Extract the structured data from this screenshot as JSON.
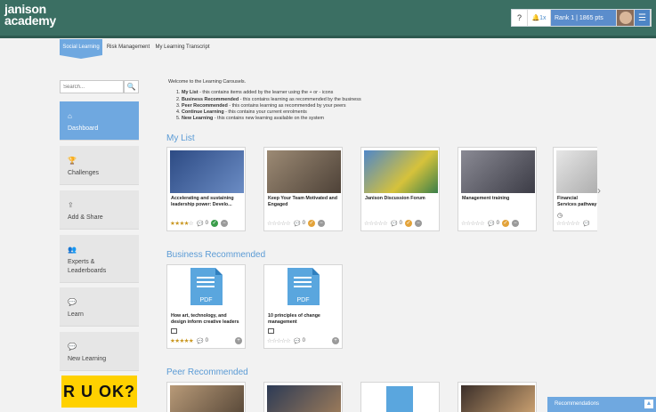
{
  "header": {
    "logo_line1": "janison",
    "logo_line2": "academy",
    "help": "?",
    "notifications": "1x",
    "rank": "Rank 1 | 1865 pts",
    "menu": "☰"
  },
  "tabs": [
    "Social Learning",
    "Risk Management",
    "My Learning Transcript"
  ],
  "search": {
    "placeholder": "Search..."
  },
  "sidebar": [
    {
      "label": "Dashboard",
      "icon": "⌂"
    },
    {
      "label": "Challenges",
      "icon": "🏆"
    },
    {
      "label": "Add & Share",
      "icon": "⇪"
    },
    {
      "label": "Experts & Leaderboards",
      "icon": "👥"
    },
    {
      "label": "Learn",
      "icon": "💬"
    },
    {
      "label": "New Learning",
      "icon": "💬"
    }
  ],
  "ruok": "R U OK?",
  "intro": {
    "welcome": "Welcome to the Learning Carousels.",
    "items": [
      {
        "b": "My List",
        "t": " - this contains items added by the learner using the + or - icons"
      },
      {
        "b": "Business Recommended",
        "t": " - this contains learning as recommended by the business"
      },
      {
        "b": "Peer Recommended",
        "t": " - this contains learning as recommended by your peers"
      },
      {
        "b": "Continue Learning",
        "t": " - this contains your current enrolments"
      },
      {
        "b": "New Learning",
        "t": " - this contains new learning available on the system"
      }
    ]
  },
  "sections": {
    "my_list": "My List",
    "business": "Business Recommended",
    "peer": "Peer Recommended"
  },
  "my_list_cards": [
    {
      "title": "Accelerating and sustaining leadership power: Develo...",
      "rating": 4,
      "comments": "0",
      "thumb_color": "#3d5f9a"
    },
    {
      "title": "Keep Your Team Motivated and Engaged",
      "rating": 0,
      "comments": "0",
      "thumb_color": "#7a6a5a"
    },
    {
      "title": "Janison Discussion Forum",
      "rating": 0,
      "comments": "0",
      "thumb_color": "#5c8cc2"
    },
    {
      "title": "Management training",
      "rating": 0,
      "comments": "0",
      "thumb_color": "#6b6b72"
    },
    {
      "title": "Financial Services pathway",
      "rating": 0,
      "comments": "",
      "thumb_color": "#c9c9c9"
    }
  ],
  "business_cards": [
    {
      "title": "How art, technology, and design inform creative leaders",
      "rating": 5,
      "comments": "0"
    },
    {
      "title": "10 principles of change management",
      "rating": 0,
      "comments": "0"
    }
  ],
  "pdf_label": "PDF",
  "recommendations": "Recommendations",
  "colors": {
    "header": "#3b6f63",
    "accent": "#6fa8e0",
    "star": "#c9961f",
    "section": "#5b9bd5"
  }
}
